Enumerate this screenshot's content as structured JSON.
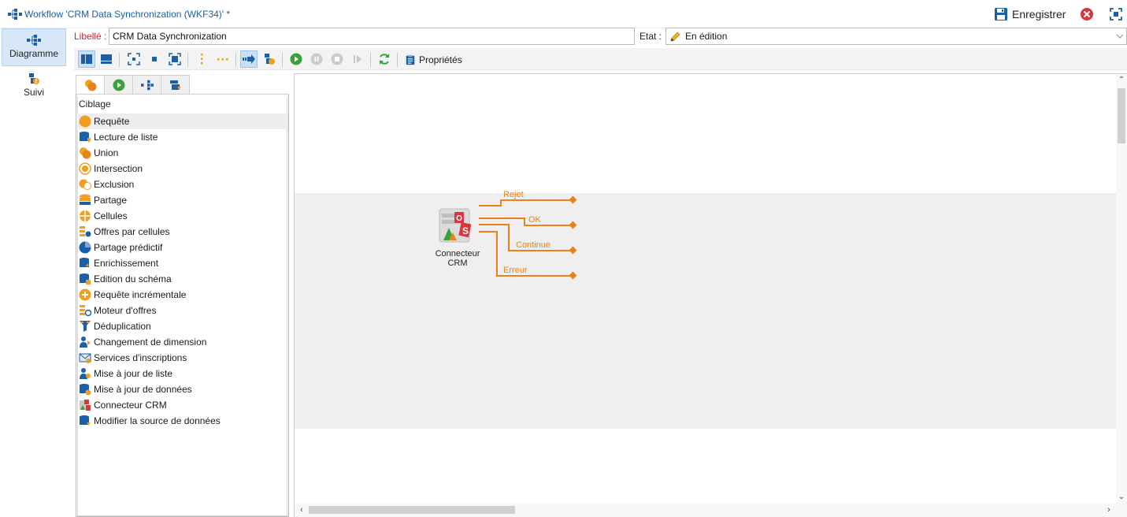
{
  "window": {
    "title": "Workflow 'CRM Data Synchronization (WKF34)' *",
    "save_label": "Enregistrer"
  },
  "nav": {
    "items": [
      {
        "label": "Diagramme",
        "icon": "workflow-diagram-icon",
        "active": true
      },
      {
        "label": "Suivi",
        "icon": "monitoring-icon",
        "active": false
      }
    ]
  },
  "form": {
    "libelle_label": "Libellé :",
    "libelle_value": "CRM Data Synchronization",
    "etat_label": "Etat :",
    "etat_value": "En édition"
  },
  "toolbar": {
    "properties_label": "Propriétés"
  },
  "palette": {
    "category": "Ciblage",
    "items": [
      {
        "label": "Requête",
        "icon": "query-icon"
      },
      {
        "label": "Lecture de liste",
        "icon": "list-read-icon"
      },
      {
        "label": "Union",
        "icon": "union-icon"
      },
      {
        "label": "Intersection",
        "icon": "intersection-icon"
      },
      {
        "label": "Exclusion",
        "icon": "exclusion-icon"
      },
      {
        "label": "Partage",
        "icon": "split-icon"
      },
      {
        "label": "Cellules",
        "icon": "cells-icon"
      },
      {
        "label": "Offres par cellules",
        "icon": "offers-by-cell-icon"
      },
      {
        "label": "Partage prédictif",
        "icon": "predictive-split-icon"
      },
      {
        "label": "Enrichissement",
        "icon": "enrichment-icon"
      },
      {
        "label": "Edition du schéma",
        "icon": "schema-edit-icon"
      },
      {
        "label": "Requête incrémentale",
        "icon": "incremental-query-icon"
      },
      {
        "label": "Moteur d'offres",
        "icon": "offer-engine-icon"
      },
      {
        "label": "Déduplication",
        "icon": "deduplication-icon"
      },
      {
        "label": "Changement de dimension",
        "icon": "change-dimension-icon"
      },
      {
        "label": "Services d'inscriptions",
        "icon": "subscription-services-icon"
      },
      {
        "label": "Mise à jour de liste",
        "icon": "list-update-icon"
      },
      {
        "label": "Mise à jour de données",
        "icon": "data-update-icon"
      },
      {
        "label": "Connecteur CRM",
        "icon": "crm-connector-icon"
      },
      {
        "label": "Modifier la source de données",
        "icon": "change-data-source-icon"
      }
    ]
  },
  "canvas": {
    "activity_label": "Connecteur CRM",
    "transitions": [
      "Rejet",
      "OK",
      "Continue",
      "Erreur"
    ]
  },
  "colors": {
    "accent_blue": "#1a5fa8",
    "label_red": "#c0282d",
    "transition_orange": "#e8831c",
    "run_green": "#3aa23a"
  }
}
